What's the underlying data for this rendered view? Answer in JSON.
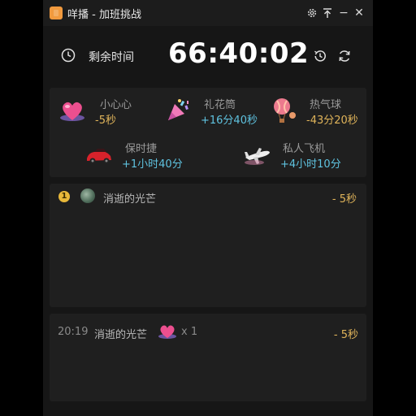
{
  "window": {
    "title": "咩播 - 加班挑战",
    "controls": {
      "settings_icon": "gear-icon",
      "pin_icon": "pin-top-icon",
      "minimize_label": "−",
      "close_label": "✕"
    }
  },
  "timer": {
    "label": "剩余时间",
    "value": "66:40:02"
  },
  "gifts": [
    {
      "name": "小心心",
      "value": "-5秒",
      "icon": "heart-gift-icon"
    },
    {
      "name": "礼花筒",
      "value": "+16分40秒",
      "icon": "party-popper-gift-icon"
    },
    {
      "name": "热气球",
      "value": "-43分20秒",
      "icon": "hot-air-balloon-gift-icon"
    },
    {
      "name": "保时捷",
      "value": "+1小时40分",
      "icon": "sports-car-gift-icon"
    },
    {
      "name": "私人飞机",
      "value": "+4小时10分",
      "icon": "private-jet-gift-icon"
    }
  ],
  "top_event": {
    "rank_badge": "1",
    "user": "消逝的光芒",
    "amount": "- 5秒"
  },
  "log_event": {
    "time": "20:19",
    "user": "消逝的光芒",
    "gift_icon": "heart-gift-icon",
    "count": "x 1",
    "amount": "- 5秒"
  },
  "colors": {
    "positive": "#5fc3e0",
    "negative": "#e0b45a",
    "accent": "#f19a3e"
  }
}
